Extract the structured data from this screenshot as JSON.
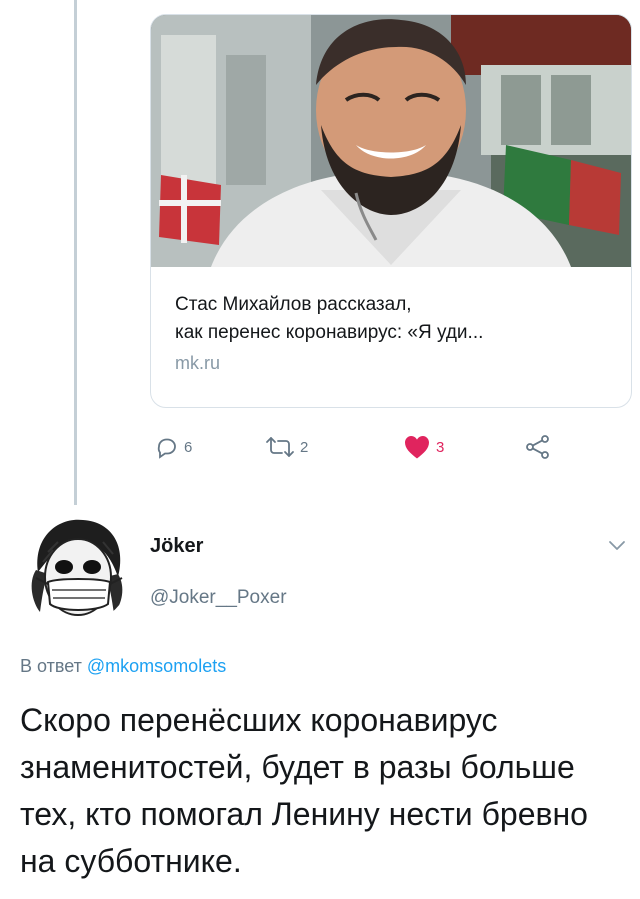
{
  "previous_tweet": {
    "link_card": {
      "title_line1": "Стас Михайлов рассказал,",
      "title_line2": "как перенес коронавирус: «Я уди...",
      "domain": "mk.ru"
    },
    "actions": {
      "reply_icon": "comment-icon",
      "replies": "6",
      "retweet_icon": "retweet-icon",
      "retweets": "2",
      "like_icon": "heart-filled-icon",
      "likes": "3",
      "share_icon": "share-icon"
    }
  },
  "reply_tweet": {
    "author": {
      "name": "Jöker",
      "handle": "@Joker__Poxer",
      "avatar_icon": "masked-joker-avatar"
    },
    "reply_prefix": "В ответ",
    "reply_to": "@mkomsomolets",
    "text": "Скоро перенёсших коронавирус знаменитостей, будет в разы больше тех, кто помогал Ленину нести бревно на субботнике."
  },
  "colors": {
    "accent": "#1da1f2",
    "like": "#e0245e",
    "secondary_text": "#657786",
    "border": "#d9e1e8"
  }
}
